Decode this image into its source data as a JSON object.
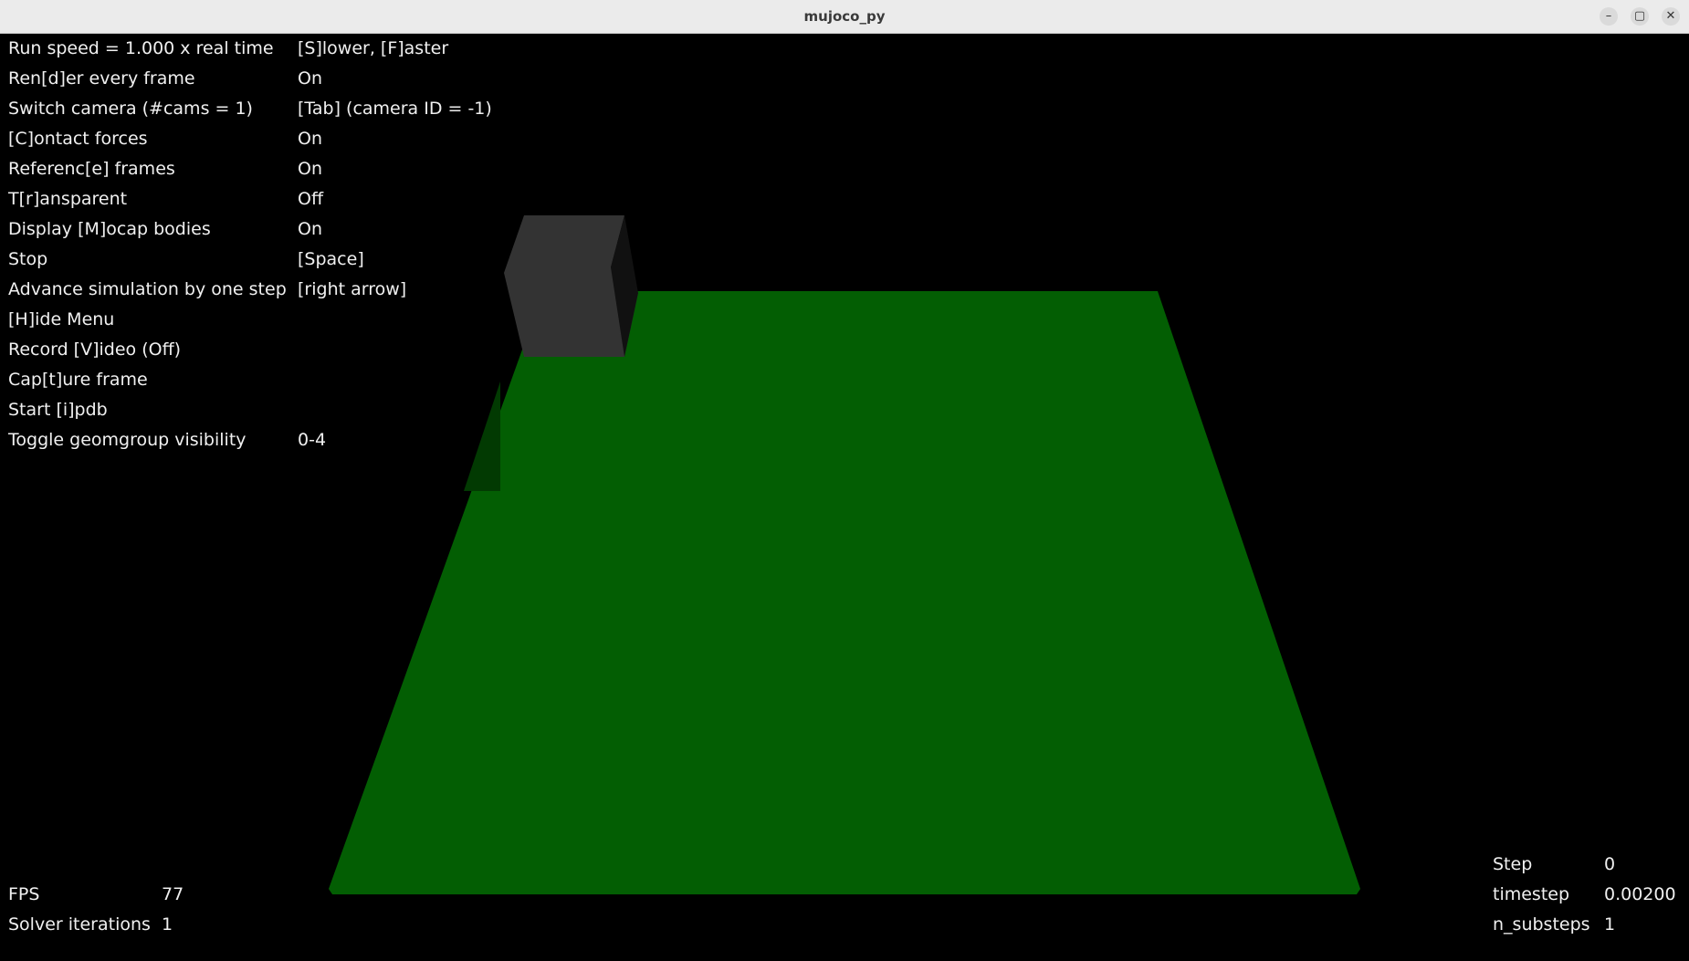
{
  "window": {
    "title": "mujoco_py",
    "minimize_icon": "–",
    "maximize_icon": "▢",
    "close_icon": "✕"
  },
  "colors": {
    "background": "#000000",
    "floor": "#035e03",
    "floor_shadow": "#023a02",
    "box_front": "#333333",
    "box_side": "#111111",
    "text": "#f0f0f0"
  },
  "menu": [
    {
      "key": "Run speed = 1.000 x real time",
      "value": "[S]lower, [F]aster"
    },
    {
      "key": "Ren[d]er every frame",
      "value": "On"
    },
    {
      "key": "Switch camera (#cams = 1)",
      "value": "[Tab] (camera ID = -1)"
    },
    {
      "key": "[C]ontact forces",
      "value": "On"
    },
    {
      "key": "Referenc[e] frames",
      "value": "On"
    },
    {
      "key": "T[r]ansparent",
      "value": "Off"
    },
    {
      "key": "Display [M]ocap bodies",
      "value": "On"
    },
    {
      "key": "Stop",
      "value": "[Space]"
    },
    {
      "key": "Advance simulation by one step",
      "value": "[right arrow]"
    },
    {
      "key": "[H]ide Menu",
      "value": ""
    },
    {
      "key": "Record [V]ideo (Off)",
      "value": ""
    },
    {
      "key": "Cap[t]ure frame",
      "value": ""
    },
    {
      "key": "Start [i]pdb",
      "value": ""
    },
    {
      "key": "Toggle geomgroup visibility",
      "value": "0-4"
    }
  ],
  "stats_left": [
    {
      "key": "FPS",
      "value": "77"
    },
    {
      "key": "Solver iterations",
      "value": "1"
    }
  ],
  "stats_right": [
    {
      "key": "Step",
      "value": "0"
    },
    {
      "key": "timestep",
      "value": "0.00200"
    },
    {
      "key": "n_substeps",
      "value": "1"
    }
  ]
}
